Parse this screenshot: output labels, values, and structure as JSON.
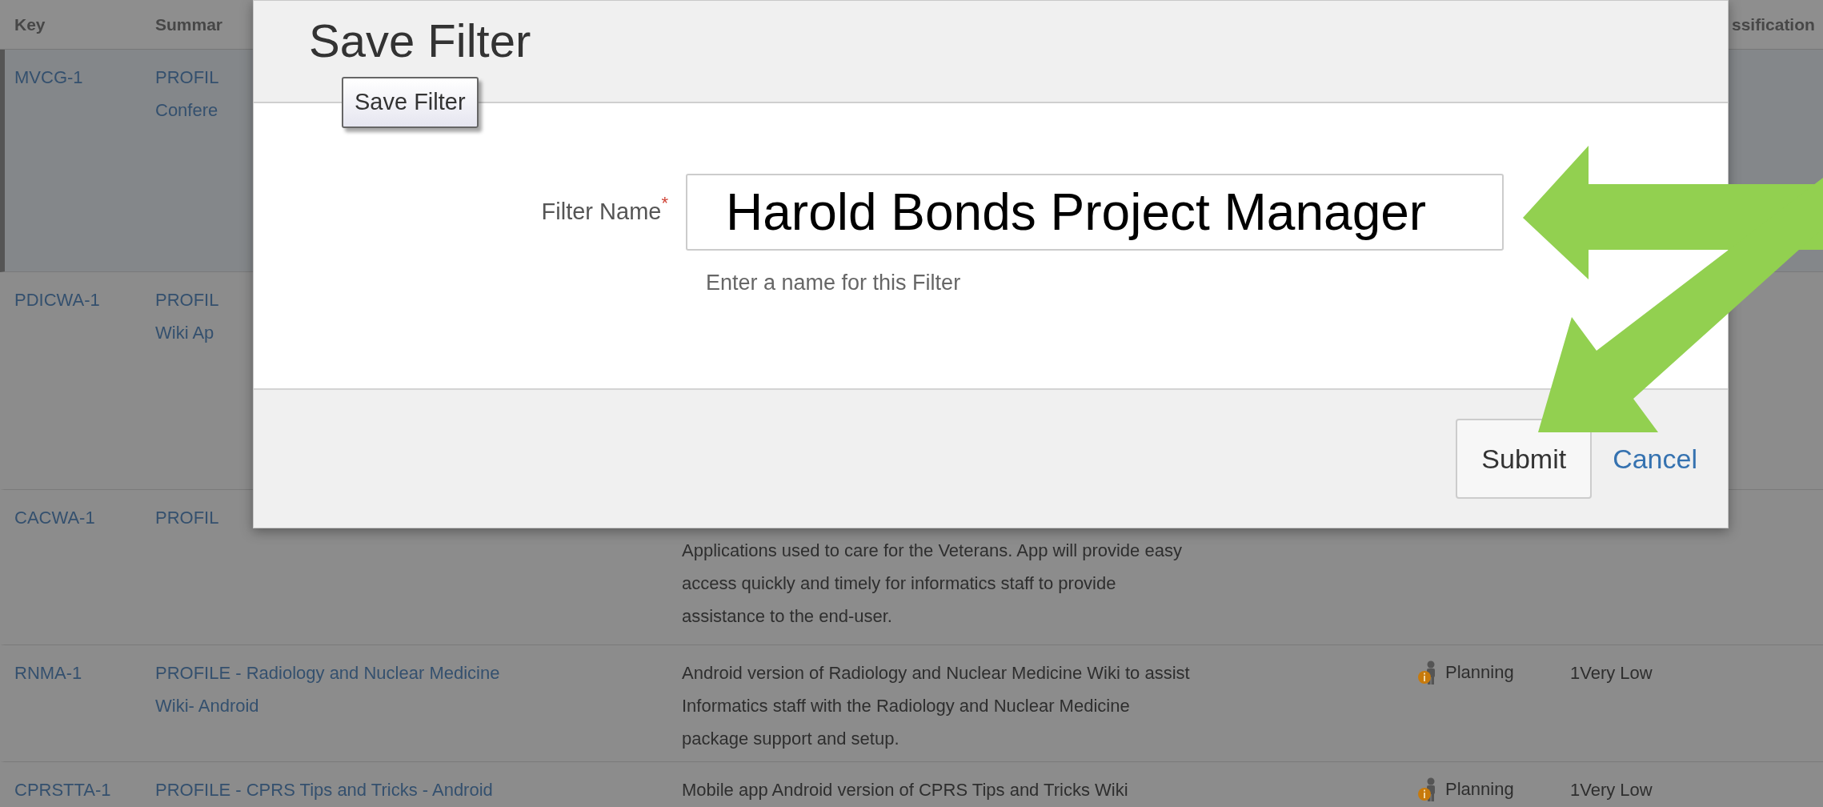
{
  "table": {
    "columns": [
      "Key",
      "Summar",
      "ssification"
    ],
    "rows": [
      {
        "kind": "plain",
        "selected": true,
        "key": "MVCG-1",
        "summary_lines": [
          "PROFIL",
          "Confere"
        ]
      },
      {
        "kind": "plain",
        "selected": false,
        "key": "PDICWA-1",
        "summary_lines": [
          "PROFIL",
          "Wiki Ap"
        ]
      },
      {
        "kind": "top_line_hidden",
        "selected": false,
        "key": "CACWA-1",
        "summary_lines": [
          "PROFIL"
        ],
        "description_lines": [
          "Applications used to care for the Veterans. App will provide easy",
          "access quickly and timely for informatics staff to provide",
          "assistance to the end-user."
        ]
      },
      {
        "kind": "plain",
        "selected": false,
        "key": "RNMA-1",
        "summary_lines": [
          "PROFILE - Radiology and Nuclear Medicine",
          "Wiki- Android"
        ],
        "description_lines": [
          "Android version of Radiology and Nuclear Medicine Wiki to assist",
          "Informatics staff with the Radiology and Nuclear Medicine",
          "package support and setup."
        ],
        "status": "Planning",
        "priority": "1Very Low"
      },
      {
        "kind": "plain",
        "selected": false,
        "key": "CPRSTTA-1",
        "summary_lines": [
          "PROFILE - CPRS Tips and Tricks - Android"
        ],
        "description_lines": [
          "Mobile app Android version of CPRS Tips and Tricks Wiki"
        ],
        "status": "Planning",
        "priority": "1Very Low"
      }
    ]
  },
  "dialog": {
    "title": "Save Filter",
    "tooltip": "Save Filter",
    "field": {
      "label": "Filter Name",
      "required_mark": "*",
      "value": "Harold Bonds Project Manager",
      "hint": "Enter a name for this Filter"
    },
    "buttons": [
      {
        "kind": "button",
        "label": "Submit"
      },
      {
        "kind": "link",
        "label": "Cancel"
      }
    ]
  }
}
